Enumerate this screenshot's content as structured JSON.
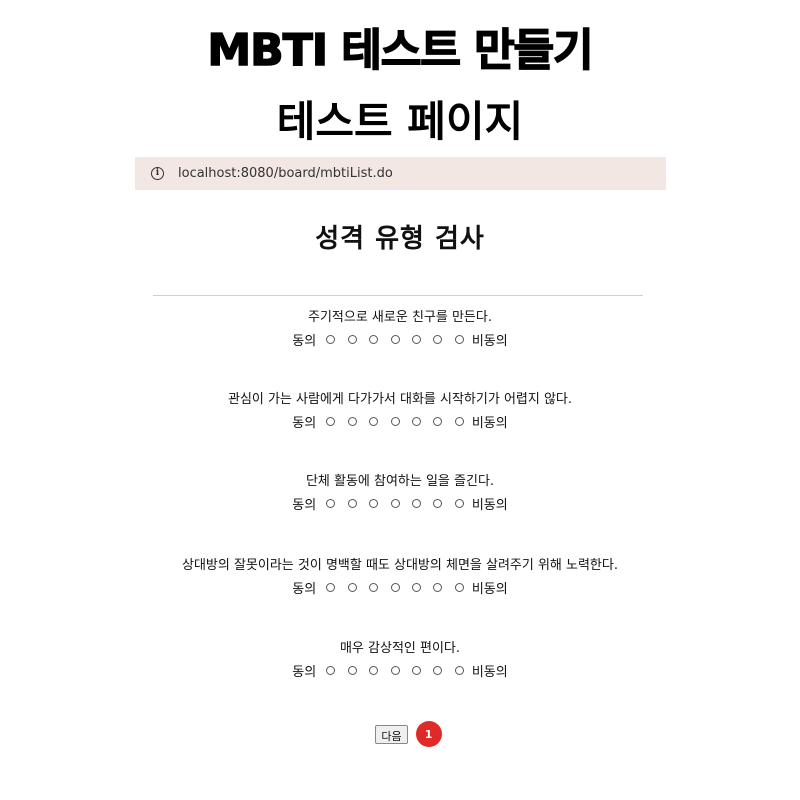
{
  "banner": {
    "title": "MBTI 테스트 만들기",
    "subtitle": "테스트 페이지"
  },
  "browser": {
    "url": "localhost:8080/board/mbtiList.do",
    "info_icon": "info-icon"
  },
  "page": {
    "heading": "성격 유형 검사"
  },
  "scale": {
    "agree_label": "동의",
    "disagree_label": "비동의",
    "option_count": 7
  },
  "questions": [
    {
      "text": "주기적으로 새로운 친구를 만든다."
    },
    {
      "text": "관심이 가는 사람에게 다가가서 대화를 시작하기가 어렵지 않다."
    },
    {
      "text": "단체 활동에 참여하는 일을 즐긴다."
    },
    {
      "text": "상대방의 잘못이라는 것이 명백할 때도 상대방의 체면을 살려주기 위해 노력한다."
    },
    {
      "text": "매우 감상적인 편이다."
    }
  ],
  "footer": {
    "next_label": "다음",
    "page_number": "1",
    "badge_color": "#e02a2a"
  }
}
